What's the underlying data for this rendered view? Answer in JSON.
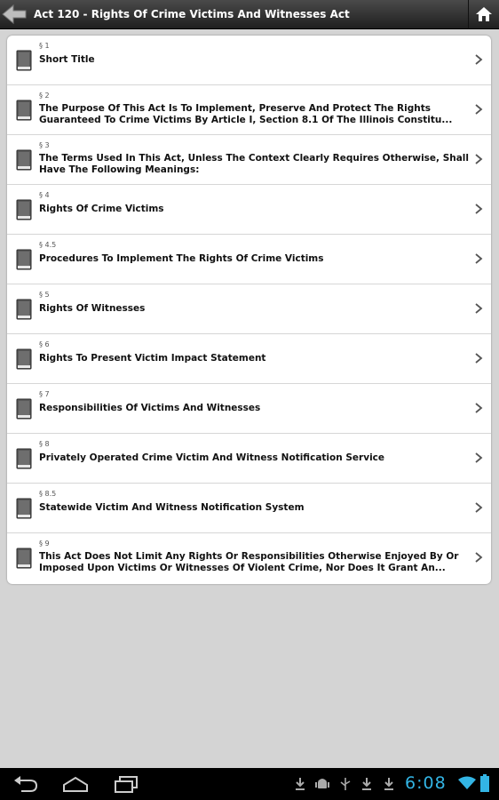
{
  "header": {
    "title": "Act 120 - Rights Of Crime Victims And Witnesses Act"
  },
  "sections": [
    {
      "number": "§ 1",
      "title": "Short Title"
    },
    {
      "number": "§ 2",
      "title": "The Purpose Of This Act Is To Implement, Preserve And Protect The Rights Guaranteed To Crime Victims By Article I, Section 8.1 Of The Illinois Constitu..."
    },
    {
      "number": "§ 3",
      "title": "The Terms Used In This Act, Unless The Context Clearly Requires Otherwise, Shall Have The Following Meanings:"
    },
    {
      "number": "§ 4",
      "title": "Rights Of Crime Victims"
    },
    {
      "number": "§ 4.5",
      "title": "Procedures To Implement The Rights Of Crime Victims"
    },
    {
      "number": "§ 5",
      "title": "Rights Of Witnesses"
    },
    {
      "number": "§ 6",
      "title": "Rights To Present Victim Impact Statement"
    },
    {
      "number": "§ 7",
      "title": "Responsibilities Of Victims And Witnesses"
    },
    {
      "number": "§ 8",
      "title": "Privately Operated Crime Victim And Witness Notification Service"
    },
    {
      "number": "§ 8.5",
      "title": "Statewide Victim And Witness Notification System"
    },
    {
      "number": "§ 9",
      "title": "This Act Does Not Limit Any Rights Or Responsibilities Otherwise Enjoyed By Or Imposed Upon Victims Or Witnesses Of Violent Crime, Nor Does It Grant An..."
    }
  ],
  "status_bar": {
    "time": "6:08"
  },
  "icons": {
    "back": "back-arrow-icon",
    "home": "home-icon",
    "book": "book-icon",
    "chevron": "chevron-right-icon"
  },
  "colors": {
    "clock": "#33b5e5",
    "titlebar": "#2b2b2b"
  }
}
